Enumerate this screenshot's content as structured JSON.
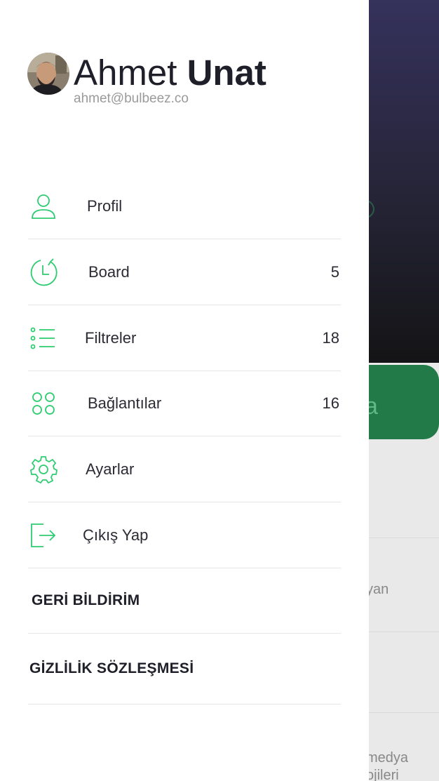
{
  "user": {
    "first_name": "Ahmet",
    "last_name": "Unat",
    "email": "ahmet@bulbeez.co"
  },
  "menu": [
    {
      "label": "Profil",
      "icon": "user-icon",
      "count": ""
    },
    {
      "label": "Board",
      "icon": "history-clock-icon",
      "count": "5"
    },
    {
      "label": "Filtreler",
      "icon": "list-icon",
      "count": "18"
    },
    {
      "label": "Bağlantılar",
      "icon": "connections-grid-icon",
      "count": "16"
    },
    {
      "label": "Ayarlar",
      "icon": "gear-icon",
      "count": ""
    },
    {
      "label": "Çıkış Yap",
      "icon": "logout-icon",
      "count": ""
    }
  ],
  "links": [
    {
      "label": "GERİ BİLDİRİM"
    },
    {
      "label": "GİZLİLİK SÖZLEŞMESİ"
    }
  ],
  "background": {
    "button_partial": "a",
    "text_1": "yan",
    "text_2": "medya",
    "text_3": "ojileri"
  },
  "colors": {
    "accent": "#2ecc71",
    "text": "#2b2b33",
    "header_bg": "#2a2840",
    "button_green": "#217a47"
  }
}
